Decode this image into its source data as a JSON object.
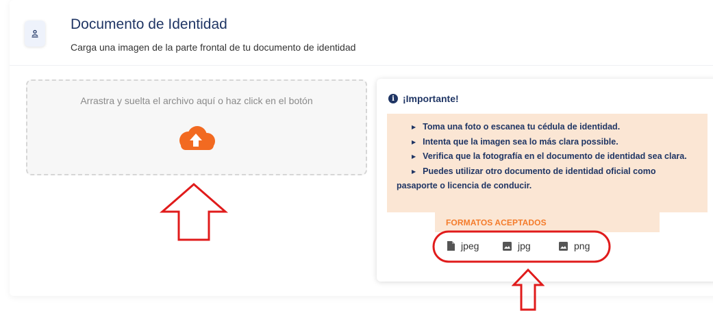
{
  "header": {
    "title": "Documento de Identidad",
    "subtitle": "Carga una imagen de la parte frontal de tu documento de identidad",
    "icon": "id-badge-icon"
  },
  "dropzone": {
    "instruction": "Arrastra y suelta el archivo aquí o haz click en el botón",
    "button_icon": "cloud-upload-icon",
    "accent_color": "#f26a21"
  },
  "important": {
    "title": "¡Importante!",
    "icon": "info-icon",
    "tips": [
      "Toma una foto o escanea tu cédula de identidad.",
      "Intenta que la imagen sea lo más clara possible.",
      "Verifica que la fotografía en el documento de identidad sea clara.",
      "Puedes utilizar otro documento de identidad oficial como pasaporte o licencia de conducir."
    ],
    "formats_label": "FORMATOS ACEPTADOS",
    "formats": [
      {
        "label": "jpeg",
        "icon": "file-icon"
      },
      {
        "label": "jpg",
        "icon": "image-icon"
      },
      {
        "label": "png",
        "icon": "image-icon"
      }
    ]
  },
  "annotations": {
    "color": "#e01b1b",
    "shapes": [
      "arrow-up",
      "arrow-up",
      "ellipse"
    ]
  }
}
